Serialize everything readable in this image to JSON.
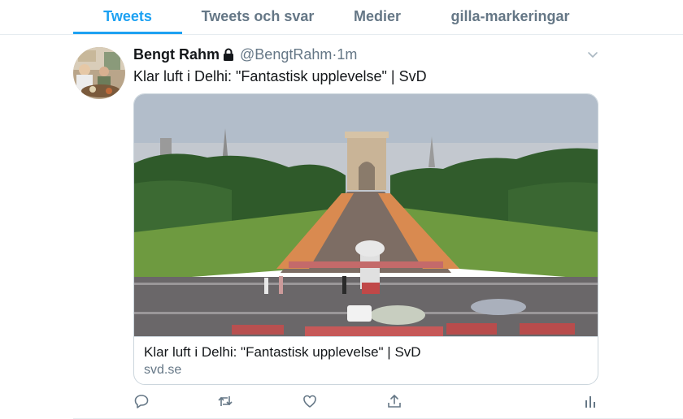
{
  "tabs": [
    {
      "label": "Tweets",
      "active": true
    },
    {
      "label": "Tweets och svar",
      "active": false
    },
    {
      "label": "Medier",
      "active": false
    },
    {
      "label": "gilla-markeringar",
      "active": false
    }
  ],
  "tweet": {
    "author_name": "Bengt Rahm",
    "handle": "@BengtRahm",
    "separator": "·",
    "time": "1m",
    "text": "Klar luft i Delhi: \"Fantastisk upplevelse\" | SvD",
    "protected_icon": "lock-icon",
    "avatar_icon": "avatar-photo"
  },
  "card": {
    "image_description_icon": "india-gate-photo",
    "title": "Klar luft i Delhi: \"Fantastisk upplevelse\" | SvD",
    "domain": "svd.se"
  },
  "actions": [
    {
      "icon": "reply-icon"
    },
    {
      "icon": "retweet-icon"
    },
    {
      "icon": "like-icon"
    },
    {
      "icon": "share-icon"
    },
    {
      "icon": "analytics-icon"
    }
  ],
  "colors": {
    "accent": "#1da1f2",
    "muted": "#657786",
    "text": "#14171a",
    "border": "#ccd6dd"
  }
}
